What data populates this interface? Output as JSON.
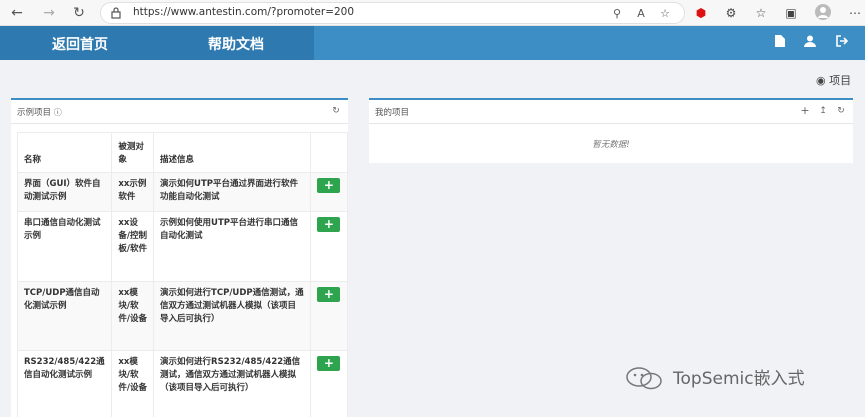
{
  "browser": {
    "url": "https://www.antestin.com/?promoter=200"
  },
  "header": {
    "home_label": "返回首页",
    "help_label": "帮助文档"
  },
  "projects_link": "项目",
  "examples_panel": {
    "title": "示例项目",
    "columns": [
      "名称",
      "被测对象",
      "描述信息"
    ],
    "rows": [
      {
        "name": "界面（GUI）软件自动测试示例",
        "target": "xx示例软件",
        "desc": "演示如何UTP平台通过界面进行软件功能自动化测试"
      },
      {
        "name": "串口通信自动化测试示例",
        "target": "xx设备/控制板/软件",
        "desc": "示例如何使用UTP平台进行串口通信自动化测试"
      },
      {
        "name": "TCP/UDP通信自动化测试示例",
        "target": "xx模块/软件/设备",
        "desc": "演示如何进行TCP/UDP通信测试，通信双方通过测试机器人模拟（该项目导入后可执行）"
      },
      {
        "name": "RS232/485/422通信自动化测试示例",
        "target": "xx模块/软件/设备",
        "desc": "演示如何进行RS232/485/422通信测试，通信双方通过测试机器人模拟（该项目导入后可执行）"
      }
    ],
    "add_symbol": "+"
  },
  "my_panel": {
    "title": "我的项目",
    "empty_text": "暂无数据!"
  },
  "watermark": "TopSemic嵌入式",
  "colors": {
    "header": "#3d8ec4",
    "header_dark": "#2e7ab0",
    "add_button": "#2ea44f"
  }
}
